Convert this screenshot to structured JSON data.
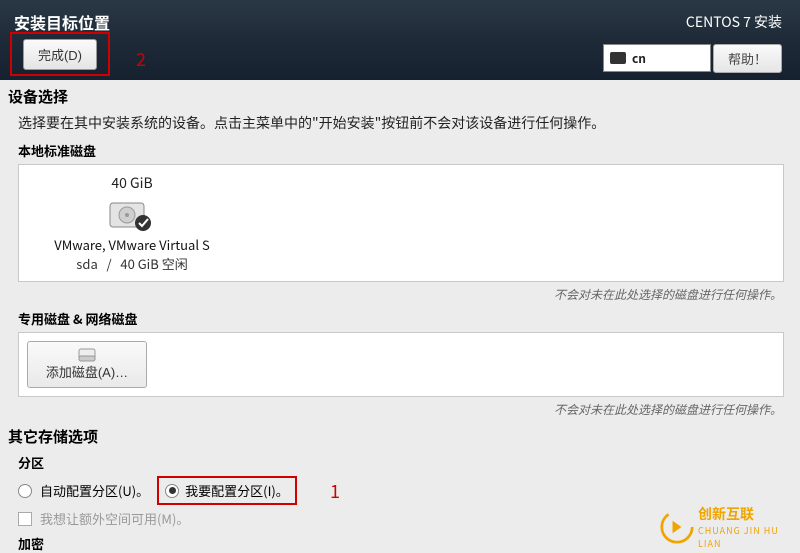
{
  "header": {
    "title": "安装目标位置",
    "done_button": "完成(D)",
    "install_brand": "CENTOS 7 安装",
    "lang_code": "cn",
    "help_button": "帮助！",
    "annotation_1": "1",
    "annotation_2": "2"
  },
  "device_selection": {
    "title": "设备选择",
    "hint": "选择要在其中安装系统的设备。点击主菜单中的\"开始安装\"按钮前不会对该设备进行任何操作。",
    "local_disks_label": "本地标准磁盘",
    "disk": {
      "size": "40 GiB",
      "name": "VMware, VMware Virtual S",
      "id": "sda",
      "free": "40 GiB 空闲",
      "separator": "/"
    },
    "note": "不会对未在此处选择的磁盘进行任何操作。",
    "special_label": "专用磁盘 & 网络磁盘",
    "add_disk_button": "添加磁盘(A)…"
  },
  "storage_options": {
    "title": "其它存储选项",
    "partition_label": "分区",
    "auto_partition": "自动配置分区(U)。",
    "manual_partition": "我要配置分区(I)。",
    "extra_space": "我想让额外空间可用(M)。",
    "encryption_label": "加密"
  },
  "logo": {
    "text": "CHUANG JIN HU LIAN"
  }
}
